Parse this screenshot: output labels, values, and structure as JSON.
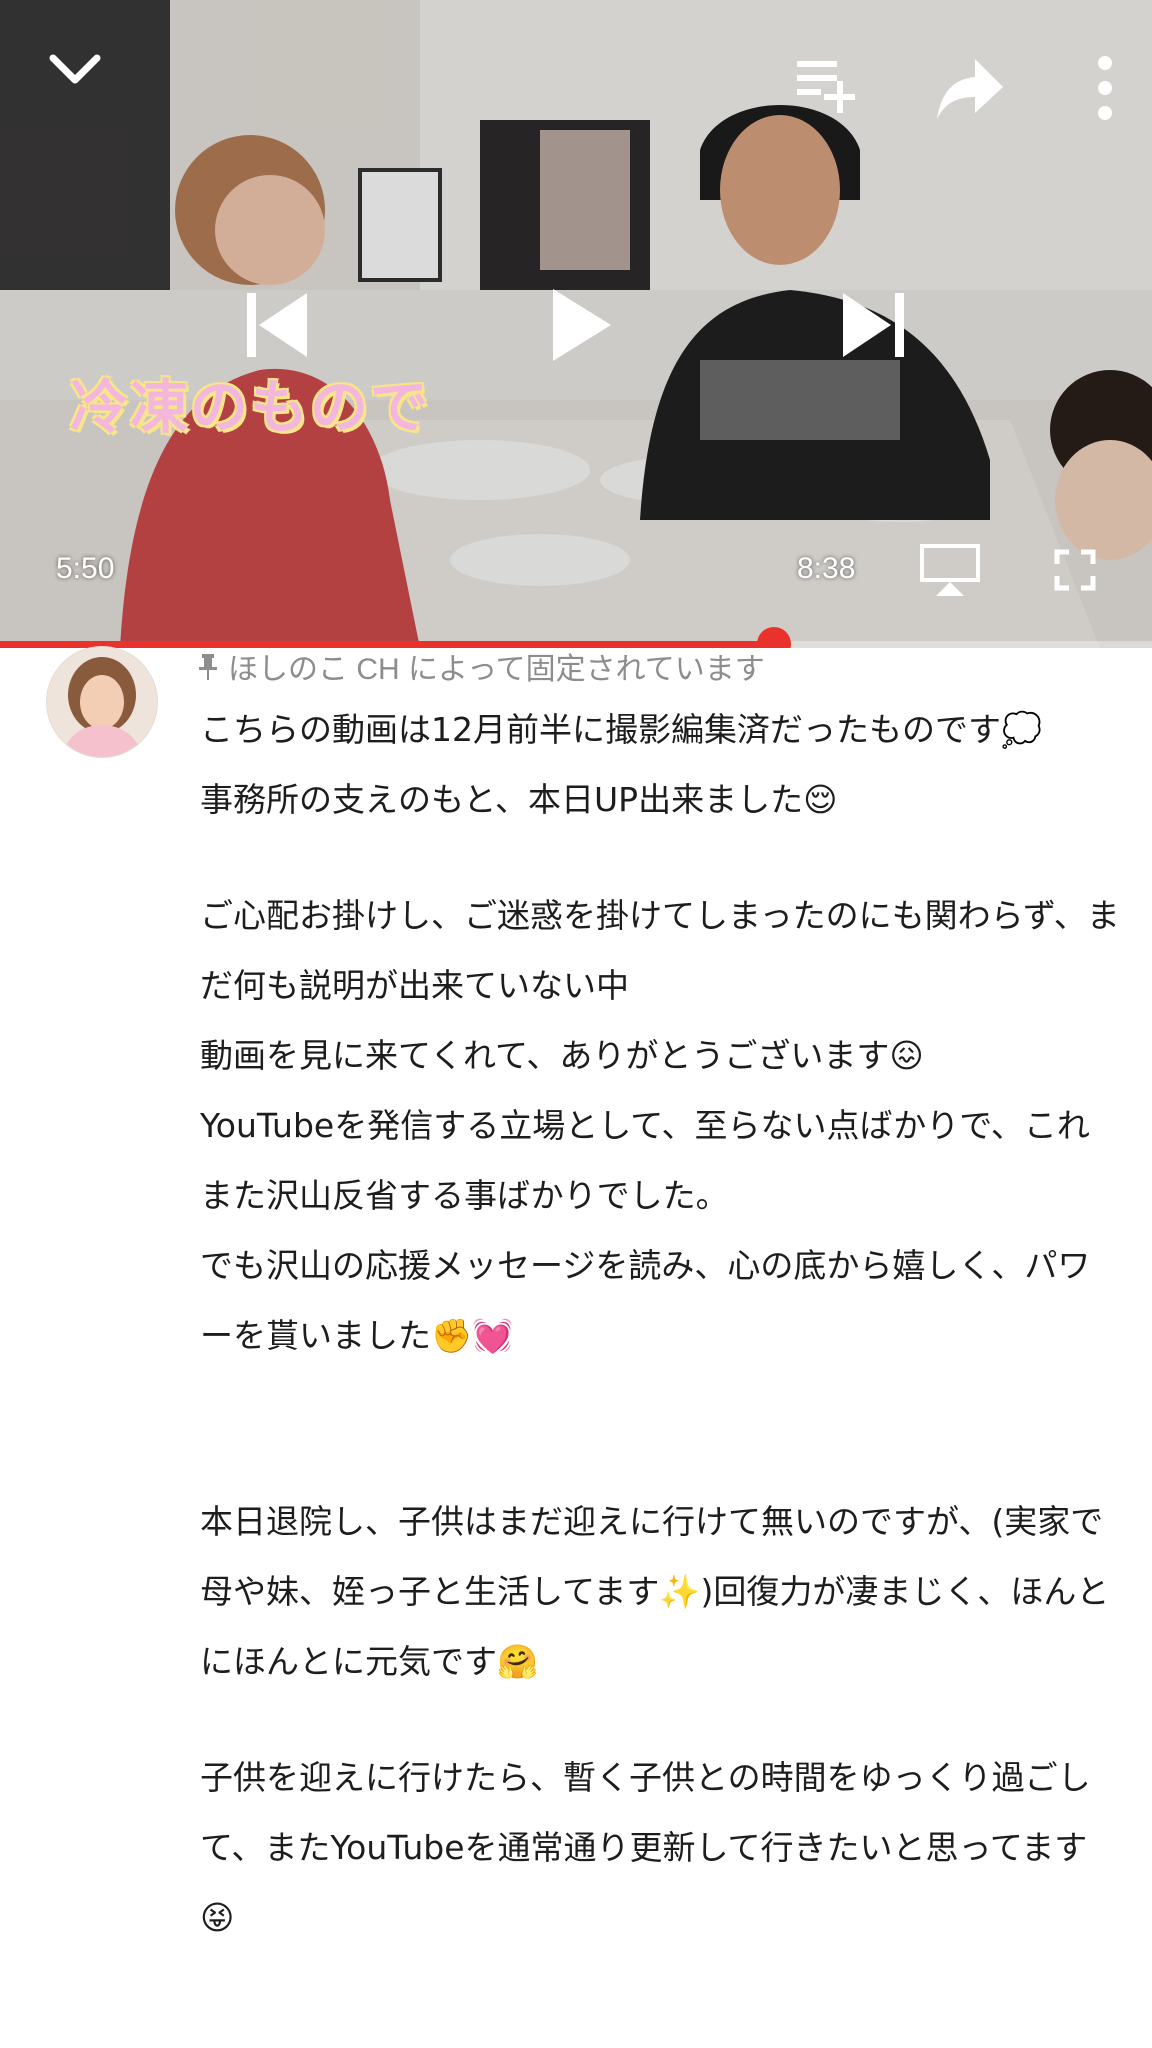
{
  "player": {
    "caption_overlay": "冷凍のもので",
    "current_time": "5:50",
    "duration": "8:38",
    "progress_fraction": 0.672,
    "accent_color": "#e8322b",
    "icons": [
      "chevron-down-icon",
      "add-to-queue-icon",
      "share-icon",
      "more-vert-icon",
      "skip-previous-icon",
      "play-icon",
      "skip-next-icon",
      "cast-icon",
      "fullscreen-icon"
    ]
  },
  "comment": {
    "pinned_label": "ほしのこ CH によって固定されています",
    "lines": [
      "こちらの動画は12月前半に撮影編集済だったものです💭",
      "事務所の支えのもと、本日UP出来ました😌",
      "ご心配お掛けし、ご迷惑を掛けてしまったのにも関わらず、まだ何も説明が出来ていない中",
      "動画を見に来てくれて、ありがとうございます😖",
      "YouTubeを発信する立場として、至らない点ばかりで、これまた沢山反省する事ばかりでした。",
      "でも沢山の応援メッセージを読み、心の底から嬉しく、パワーを貰いました✊💓",
      "本日退院し、子供はまだ迎えに行けて無いのですが、(実家で母や妹、姪っ子と生活してます✨)回復力が凄まじく、ほんとにほんとに元気です🤗",
      "子供を迎えに行けたら、暫く子供との時間をゆっくり過ごして、またYouTubeを通常通り更新して行きたいと思ってます😝"
    ]
  }
}
